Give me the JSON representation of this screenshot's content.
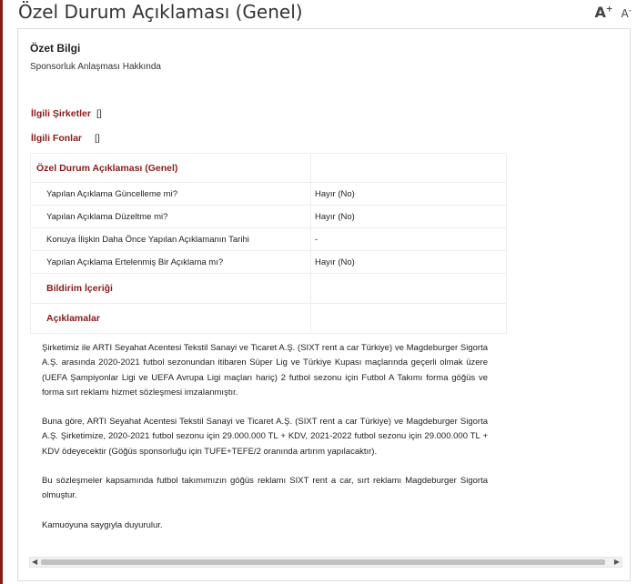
{
  "page": {
    "title": "Özel Durum Açıklaması (Genel)",
    "font_increase": "A",
    "font_increase_sign": "+",
    "font_decrease": "A",
    "font_decrease_sign": "-"
  },
  "summary": {
    "title": "Özet Bilgi",
    "subtitle": "Sponsorluk Anlaşması Hakkında"
  },
  "related": {
    "companies_label": "İlgili Şirketler",
    "companies_value": "[]",
    "funds_label": "İlgili Fonlar",
    "funds_value": "[]"
  },
  "details": {
    "header": "Özel Durum Açıklaması (Genel)",
    "rows": [
      {
        "label": "Yapılan Açıklama Güncelleme mi?",
        "value": "Hayır (No)"
      },
      {
        "label": "Yapılan Açıklama Düzeltme mi?",
        "value": "Hayır (No)"
      },
      {
        "label": "Konuya İlişkin Daha Önce Yapılan Açıklamanın Tarihi",
        "value": "-"
      },
      {
        "label": "Yapılan Açıklama Ertelenmiş Bir Açıklama mı?",
        "value": "Hayır (No)"
      }
    ],
    "section_notification": "Bildirim İçeriği",
    "section_explanations": "Açıklamalar"
  },
  "content": {
    "paragraphs": [
      "Şirketimiz ile ARTI Seyahat Acentesi Tekstil Sanayi ve Ticaret A.Ş. (SIXT rent a car Türkiye) ve Magdeburger Sigorta A.Ş. arasında 2020-2021 futbol sezonundan itibaren Süper Lig ve Türkiye Kupası maçlarında geçerli olmak üzere (UEFA Şampiyonlar Ligi ve UEFA Avrupa Ligi maçları hariç) 2 futbol sezonu için Futbol A Takımı forma göğüs ve forma sırt reklamı hizmet sözleşmesi imzalanmıştır.",
      "Buna göre, ARTI Seyahat Acentesi Tekstil Sanayi ve Ticaret A.Ş. (SIXT rent a car Türkiye) ve Magdeburger Sigorta A.Ş. Şirketimize, 2020-2021 futbol sezonu için 29.000.000 TL + KDV, 2021-2022 futbol sezonu için 29.000.000 TL + KDV ödeyecektir (Göğüs sponsorluğu için TUFE+TEFE/2 oranında artırım yapılacaktır).",
      "Bu sözleşmeler kapsamında futbol takımımızın göğüs reklamı SIXT rent a car, sırt reklamı Magdeburger Sigorta olmuştur.",
      "Kamuoyuna saygıyla duyurulur."
    ]
  },
  "scrollbar": {
    "left_arrow": "◀",
    "right_arrow": "▶"
  }
}
